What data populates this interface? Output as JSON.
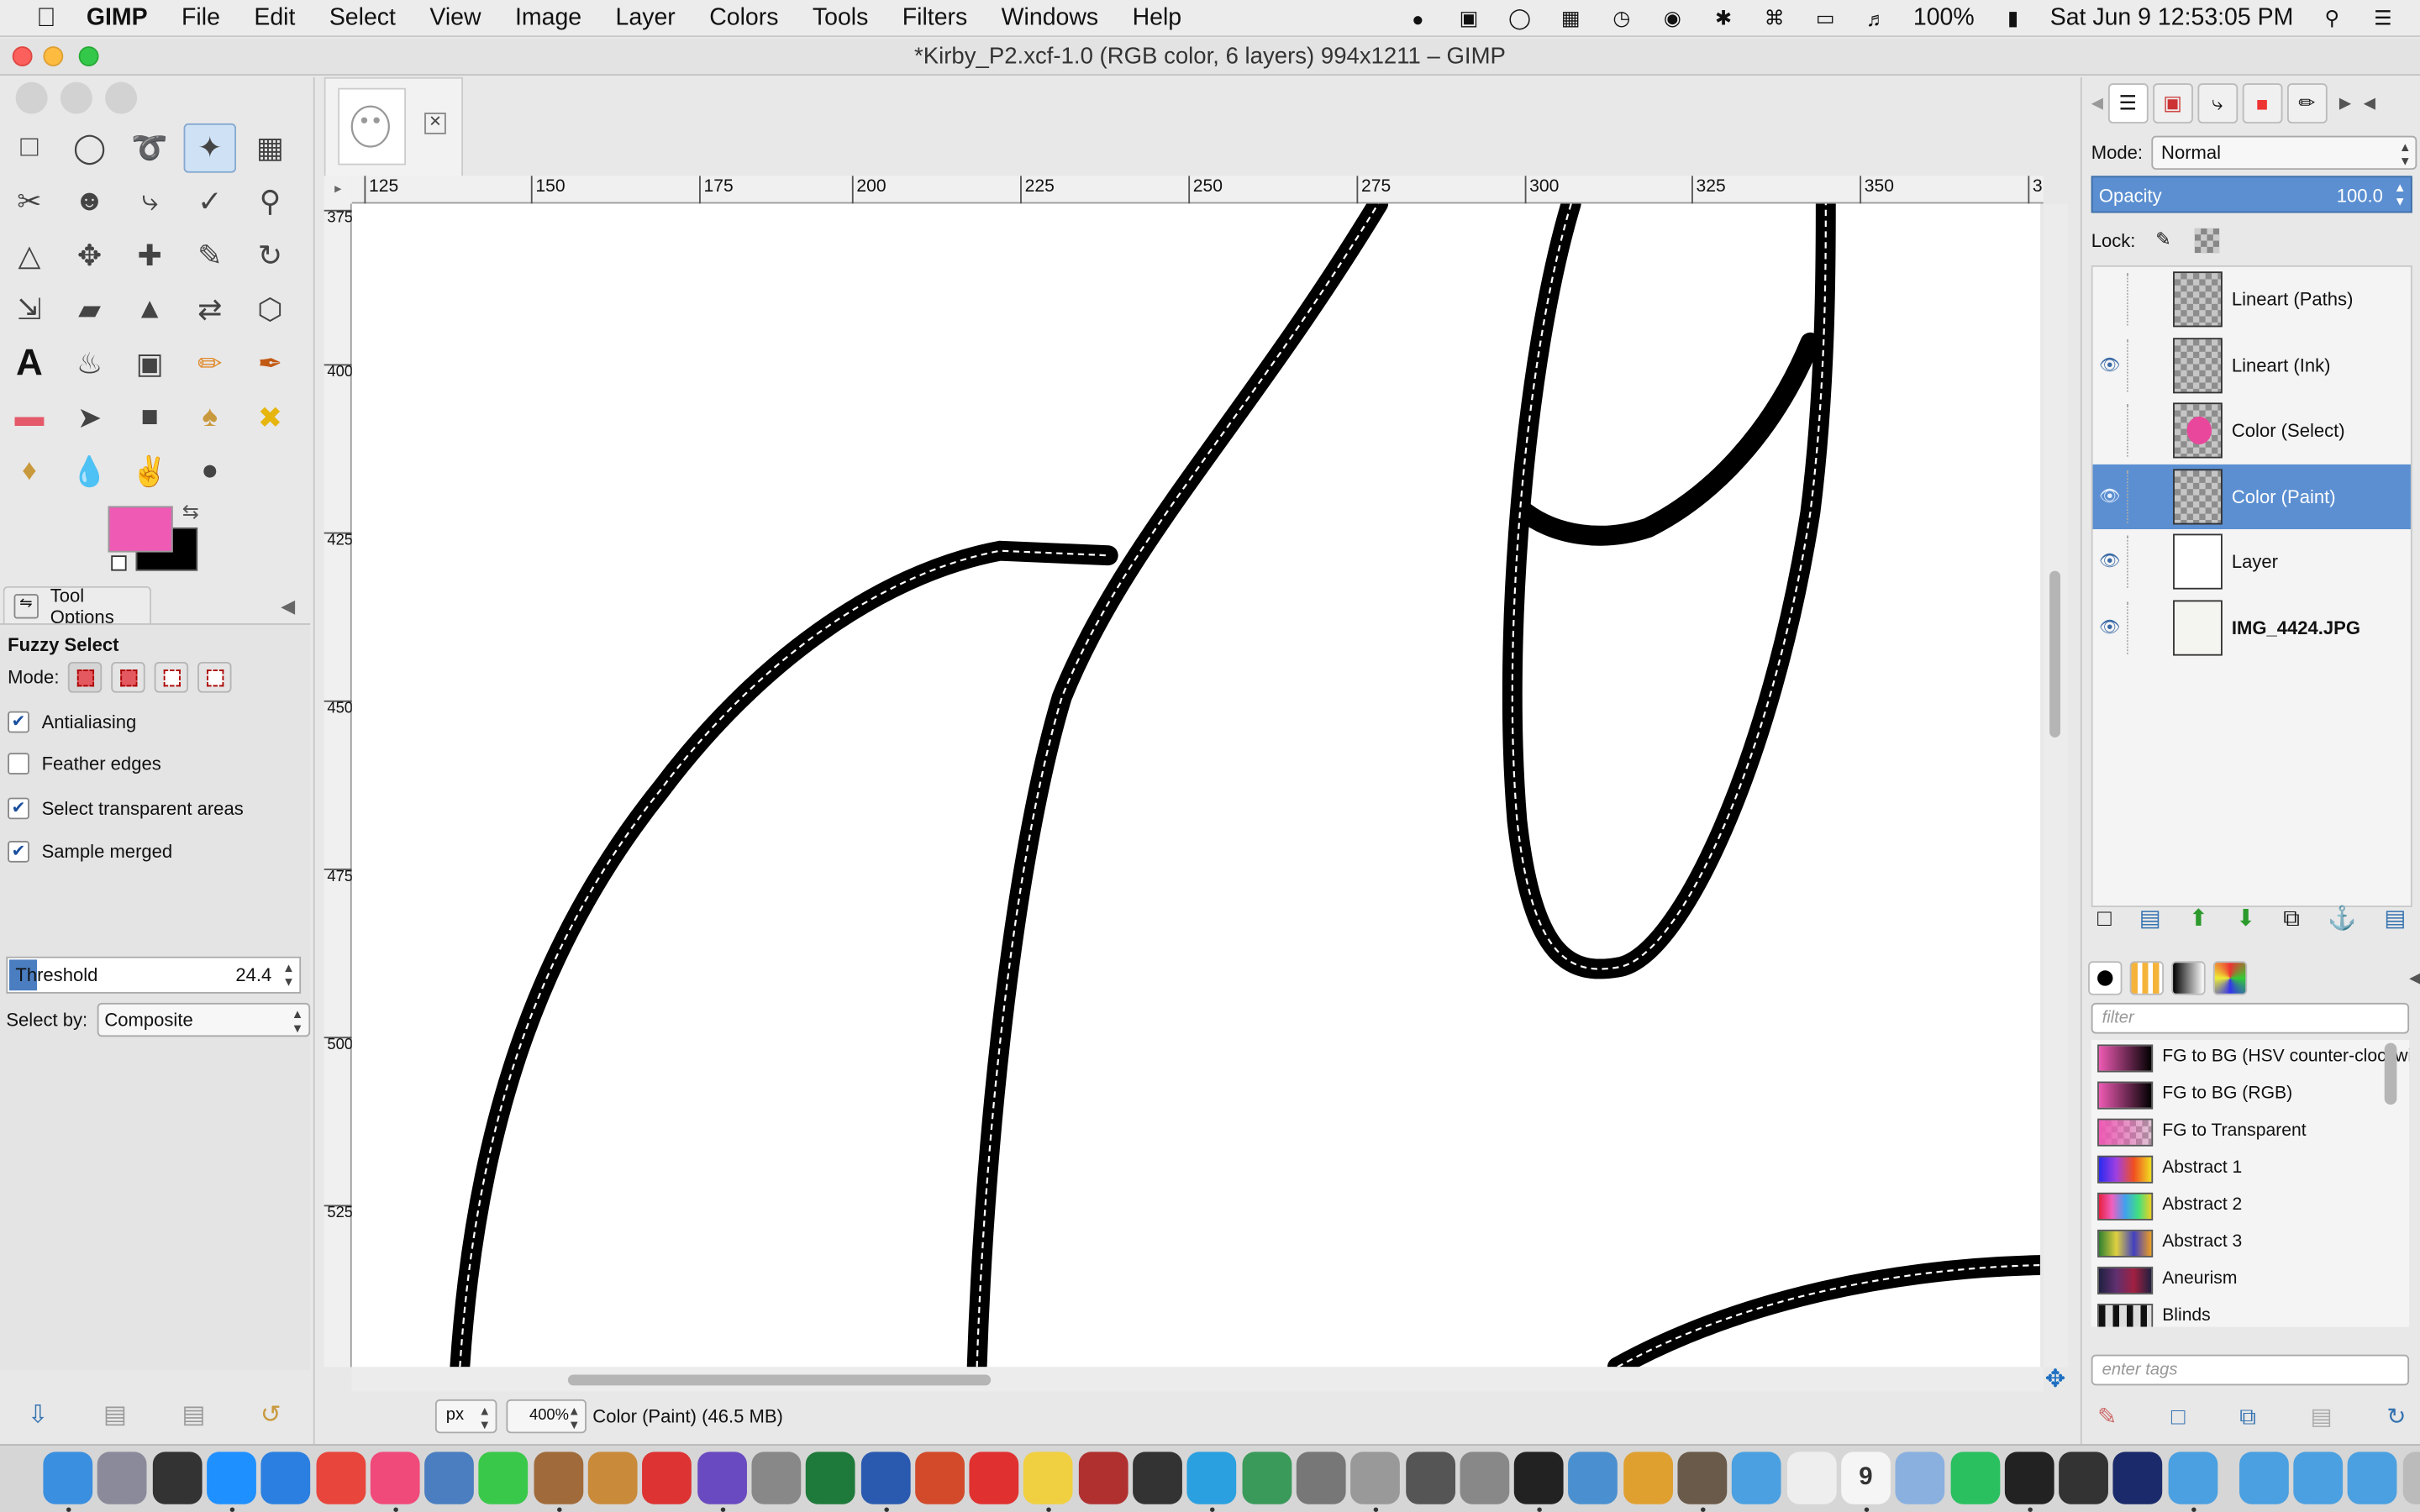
{
  "menubar": {
    "apple": "",
    "app": "GIMP",
    "items": [
      "File",
      "Edit",
      "Select",
      "View",
      "Image",
      "Layer",
      "Colors",
      "Tools",
      "Filters",
      "Windows",
      "Help"
    ],
    "battery": "100%",
    "datetime": "Sat Jun 9  12:53:05 PM"
  },
  "window": {
    "title": "*Kirby_P2.xcf-1.0 (RGB color, 6 layers) 994x1211 – GIMP"
  },
  "tool_options": {
    "tab_label": "Tool Options",
    "tool_name": "Fuzzy Select",
    "mode_label": "Mode:",
    "antialiasing_label": "Antialiasing",
    "feather_label": "Feather edges",
    "select_transparent_label": "Select transparent areas",
    "sample_merged_label": "Sample merged",
    "threshold_label": "Threshold",
    "threshold_value": "24.4",
    "select_by_label": "Select by:",
    "select_by_value": "Composite",
    "antialiasing_checked": true,
    "feather_checked": false,
    "select_transparent_checked": true,
    "sample_merged_checked": true
  },
  "colors": {
    "foreground": "#ee5ab4",
    "background": "#000000",
    "selection_active": "#5b8fd1"
  },
  "ruler": {
    "h_ticks": [
      "125",
      "150",
      "175",
      "200",
      "225",
      "250",
      "275",
      "300",
      "325",
      "350",
      "3"
    ],
    "v_ticks": [
      "375",
      "400",
      "425",
      "450",
      "475",
      "500",
      "525"
    ]
  },
  "status": {
    "unit": "px",
    "zoom": "400%",
    "text": "Color (Paint) (46.5 MB)"
  },
  "layers_panel": {
    "mode_label": "Mode:",
    "mode_value": "Normal",
    "opacity_label": "Opacity",
    "opacity_value": "100.0",
    "lock_label": "Lock:",
    "layers": [
      {
        "name": "Lineart (Paths)",
        "visible": false,
        "selected": false
      },
      {
        "name": "Lineart (Ink)",
        "visible": true,
        "selected": false
      },
      {
        "name": "Color (Select)",
        "visible": false,
        "selected": false
      },
      {
        "name": "Color (Paint)",
        "visible": true,
        "selected": true
      },
      {
        "name": "Layer",
        "visible": true,
        "selected": false
      },
      {
        "name": "IMG_4424.JPG",
        "visible": true,
        "selected": false
      }
    ]
  },
  "gradients_panel": {
    "filter_placeholder": "filter",
    "tags_placeholder": "enter tags",
    "gradients": [
      "FG to BG (HSV counter-clockwise)",
      "FG to BG (RGB)",
      "FG to Transparent",
      "Abstract 1",
      "Abstract 2",
      "Abstract 3",
      "Aneurism",
      "Blinds"
    ]
  },
  "dock_apps": [
    "Finder",
    "Launchpad",
    "Steam",
    "App Store",
    "Safari",
    "Chrome",
    "iTunes",
    "Preview",
    "Messages",
    "Notes",
    "Guitar",
    "Photo Booth",
    "iMovie",
    "System Preferences",
    "Excel",
    "Word",
    "PowerPoint",
    "Opera",
    "Stickies",
    "Dictionary",
    "QuickTime",
    "Skitch",
    "Maps",
    "Image Capture",
    "Scripts",
    "Crop",
    "Disk Utility",
    "Unity",
    "Preview",
    "Photos",
    "GIMP",
    "Gardener",
    "Pages",
    "Calendar",
    "Cube",
    "Grammarly",
    "Terminal",
    "Pixelmator",
    "Photoshop",
    "Folder",
    "Downloads",
    "Documents",
    "Folder",
    "Trash"
  ],
  "dock_calendar_day": "9"
}
